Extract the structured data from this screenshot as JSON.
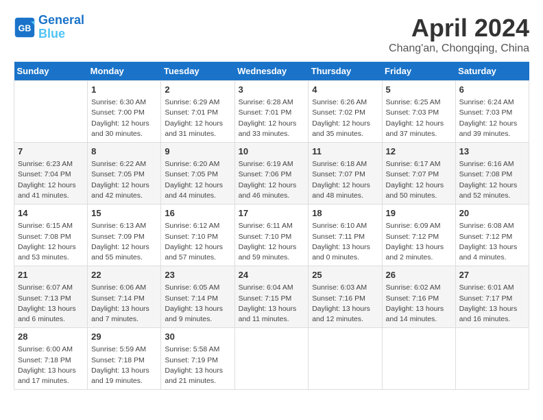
{
  "header": {
    "logo_line1": "General",
    "logo_line2": "Blue",
    "month": "April 2024",
    "location": "Chang'an, Chongqing, China"
  },
  "columns": [
    "Sunday",
    "Monday",
    "Tuesday",
    "Wednesday",
    "Thursday",
    "Friday",
    "Saturday"
  ],
  "weeks": [
    [
      {
        "day": "",
        "info": ""
      },
      {
        "day": "1",
        "info": "Sunrise: 6:30 AM\nSunset: 7:00 PM\nDaylight: 12 hours\nand 30 minutes."
      },
      {
        "day": "2",
        "info": "Sunrise: 6:29 AM\nSunset: 7:01 PM\nDaylight: 12 hours\nand 31 minutes."
      },
      {
        "day": "3",
        "info": "Sunrise: 6:28 AM\nSunset: 7:01 PM\nDaylight: 12 hours\nand 33 minutes."
      },
      {
        "day": "4",
        "info": "Sunrise: 6:26 AM\nSunset: 7:02 PM\nDaylight: 12 hours\nand 35 minutes."
      },
      {
        "day": "5",
        "info": "Sunrise: 6:25 AM\nSunset: 7:03 PM\nDaylight: 12 hours\nand 37 minutes."
      },
      {
        "day": "6",
        "info": "Sunrise: 6:24 AM\nSunset: 7:03 PM\nDaylight: 12 hours\nand 39 minutes."
      }
    ],
    [
      {
        "day": "7",
        "info": "Sunrise: 6:23 AM\nSunset: 7:04 PM\nDaylight: 12 hours\nand 41 minutes."
      },
      {
        "day": "8",
        "info": "Sunrise: 6:22 AM\nSunset: 7:05 PM\nDaylight: 12 hours\nand 42 minutes."
      },
      {
        "day": "9",
        "info": "Sunrise: 6:20 AM\nSunset: 7:05 PM\nDaylight: 12 hours\nand 44 minutes."
      },
      {
        "day": "10",
        "info": "Sunrise: 6:19 AM\nSunset: 7:06 PM\nDaylight: 12 hours\nand 46 minutes."
      },
      {
        "day": "11",
        "info": "Sunrise: 6:18 AM\nSunset: 7:07 PM\nDaylight: 12 hours\nand 48 minutes."
      },
      {
        "day": "12",
        "info": "Sunrise: 6:17 AM\nSunset: 7:07 PM\nDaylight: 12 hours\nand 50 minutes."
      },
      {
        "day": "13",
        "info": "Sunrise: 6:16 AM\nSunset: 7:08 PM\nDaylight: 12 hours\nand 52 minutes."
      }
    ],
    [
      {
        "day": "14",
        "info": "Sunrise: 6:15 AM\nSunset: 7:08 PM\nDaylight: 12 hours\nand 53 minutes."
      },
      {
        "day": "15",
        "info": "Sunrise: 6:13 AM\nSunset: 7:09 PM\nDaylight: 12 hours\nand 55 minutes."
      },
      {
        "day": "16",
        "info": "Sunrise: 6:12 AM\nSunset: 7:10 PM\nDaylight: 12 hours\nand 57 minutes."
      },
      {
        "day": "17",
        "info": "Sunrise: 6:11 AM\nSunset: 7:10 PM\nDaylight: 12 hours\nand 59 minutes."
      },
      {
        "day": "18",
        "info": "Sunrise: 6:10 AM\nSunset: 7:11 PM\nDaylight: 13 hours\nand 0 minutes."
      },
      {
        "day": "19",
        "info": "Sunrise: 6:09 AM\nSunset: 7:12 PM\nDaylight: 13 hours\nand 2 minutes."
      },
      {
        "day": "20",
        "info": "Sunrise: 6:08 AM\nSunset: 7:12 PM\nDaylight: 13 hours\nand 4 minutes."
      }
    ],
    [
      {
        "day": "21",
        "info": "Sunrise: 6:07 AM\nSunset: 7:13 PM\nDaylight: 13 hours\nand 6 minutes."
      },
      {
        "day": "22",
        "info": "Sunrise: 6:06 AM\nSunset: 7:14 PM\nDaylight: 13 hours\nand 7 minutes."
      },
      {
        "day": "23",
        "info": "Sunrise: 6:05 AM\nSunset: 7:14 PM\nDaylight: 13 hours\nand 9 minutes."
      },
      {
        "day": "24",
        "info": "Sunrise: 6:04 AM\nSunset: 7:15 PM\nDaylight: 13 hours\nand 11 minutes."
      },
      {
        "day": "25",
        "info": "Sunrise: 6:03 AM\nSunset: 7:16 PM\nDaylight: 13 hours\nand 12 minutes."
      },
      {
        "day": "26",
        "info": "Sunrise: 6:02 AM\nSunset: 7:16 PM\nDaylight: 13 hours\nand 14 minutes."
      },
      {
        "day": "27",
        "info": "Sunrise: 6:01 AM\nSunset: 7:17 PM\nDaylight: 13 hours\nand 16 minutes."
      }
    ],
    [
      {
        "day": "28",
        "info": "Sunrise: 6:00 AM\nSunset: 7:18 PM\nDaylight: 13 hours\nand 17 minutes."
      },
      {
        "day": "29",
        "info": "Sunrise: 5:59 AM\nSunset: 7:18 PM\nDaylight: 13 hours\nand 19 minutes."
      },
      {
        "day": "30",
        "info": "Sunrise: 5:58 AM\nSunset: 7:19 PM\nDaylight: 13 hours\nand 21 minutes."
      },
      {
        "day": "",
        "info": ""
      },
      {
        "day": "",
        "info": ""
      },
      {
        "day": "",
        "info": ""
      },
      {
        "day": "",
        "info": ""
      }
    ]
  ]
}
